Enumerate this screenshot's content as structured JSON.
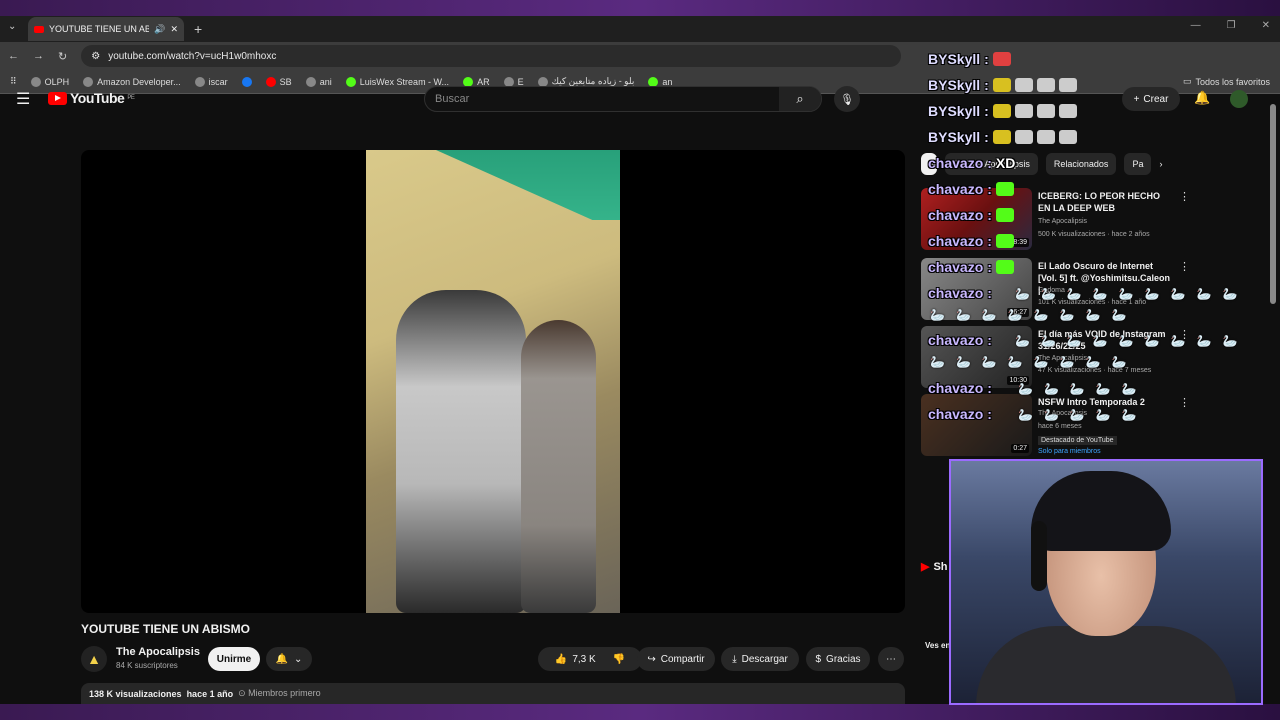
{
  "browser": {
    "tab_title": "YOUTUBE TIENE UN ABISMO",
    "url": "youtube.com/watch?v=ucH1w0mhoxc",
    "bookmarks": [
      "OLPH",
      "Amazon Developer...",
      "iscar",
      "",
      "SB",
      "ani",
      "LuisWex Stream - W...",
      "AR",
      "E",
      "بلو - زياده متابعين كيك",
      "an"
    ],
    "all_bookmarks": "Todos los favoritos"
  },
  "header": {
    "logo_text": "YouTube",
    "logo_region": "PE",
    "search_placeholder": "Buscar",
    "create_label": "Crear"
  },
  "video": {
    "title": "YOUTUBE TIENE UN ABISMO",
    "channel_name": "The Apocalipsis",
    "subscribers": "84 K suscriptores",
    "join_label": "Unirme",
    "likes": "7,3 K",
    "share_label": "Compartir",
    "download_label": "Descargar",
    "thanks_label": "Gracias",
    "views": "138 K visualizaciones",
    "age": "hace 1 año",
    "members_first": "Miembros primero"
  },
  "chips": [
    "",
    "De The Apocalipsis",
    "Relacionados",
    "Pa"
  ],
  "recommendations": [
    {
      "title": "ICEBERG: LO PEOR HECHO EN LA DEEP WEB",
      "channel": "The Apocalipsis",
      "meta": "500 K visualizaciones · hace 2 años",
      "duration": "18:39"
    },
    {
      "title": "El Lado Oscuro de Internet [Vol. 5] ft. @Yoshimitsu.Caleon | ...",
      "channel": "Godoma",
      "meta": "101 K visualizaciones · hace 1 año",
      "duration": "16:27"
    },
    {
      "title": "El día más VOID de Instagram 31/26/22/25",
      "channel": "The Apocalipsis",
      "meta": "47 K visualizaciones · hace 7 meses",
      "duration": "10:30"
    },
    {
      "title": "NSFW Intro Temporada 2",
      "channel": "The Apocalipsis",
      "meta": "hace 6 meses",
      "duration": "0:27",
      "badge": "Destacado de YouTube",
      "members": "Solo para miembros"
    }
  ],
  "chat": [
    {
      "user": "BYSkyll",
      "text": ""
    },
    {
      "user": "BYSkyll",
      "text": ""
    },
    {
      "user": "BYSkyll",
      "text": ""
    },
    {
      "user": "BYSkyll",
      "text": ""
    },
    {
      "user": "chavazo",
      "text": "XD"
    },
    {
      "user": "chavazo",
      "text": ""
    },
    {
      "user": "chavazo",
      "text": ""
    },
    {
      "user": "chavazo",
      "text": ""
    },
    {
      "user": "chavazo",
      "text": ""
    },
    {
      "user": "chavazo",
      "text": ""
    },
    {
      "user": "chavazo",
      "text": ""
    },
    {
      "user": "chavazo",
      "text": ""
    },
    {
      "user": "chavazo",
      "text": ""
    }
  ],
  "shorts_label": "Sh",
  "bottom_label": "Ves en",
  "colors": {
    "accent": "#9b6bff",
    "yt_red": "#ff0000"
  }
}
